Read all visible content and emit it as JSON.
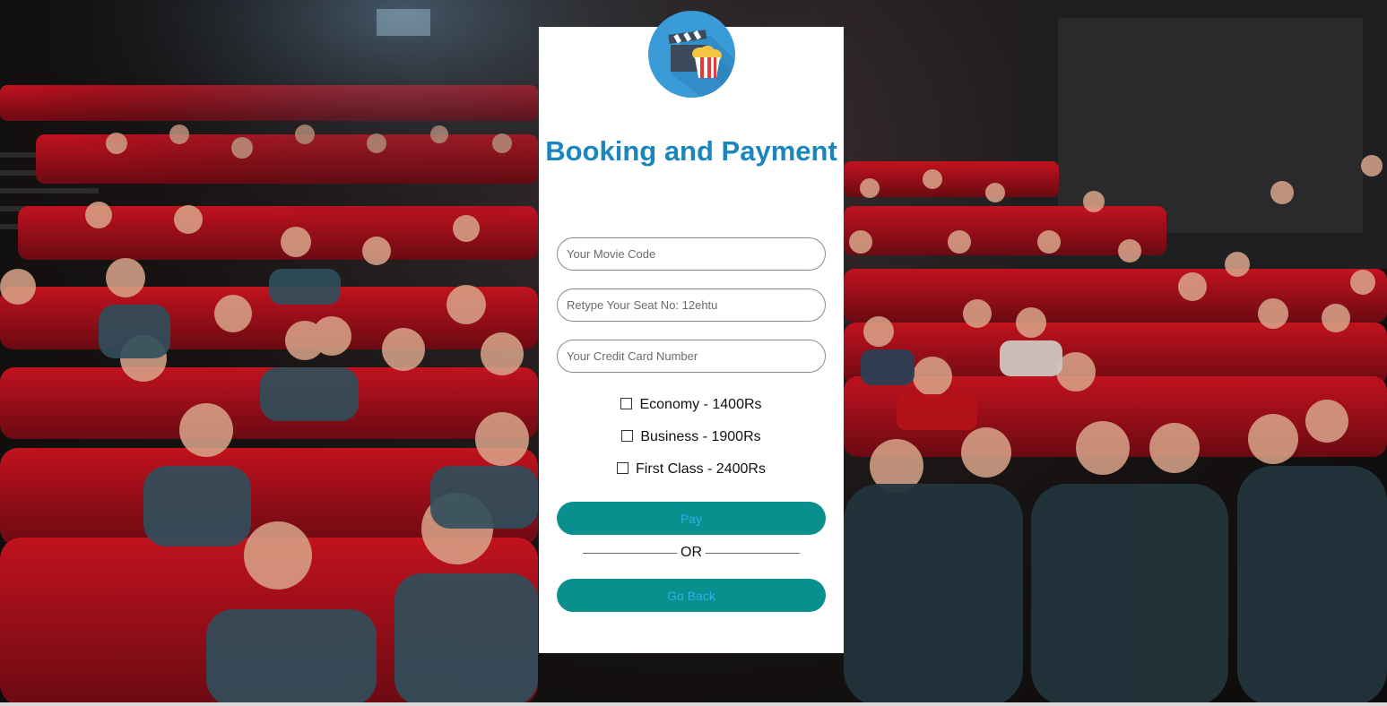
{
  "form": {
    "title": "Booking and Payment",
    "movie_code": {
      "placeholder": "Your Movie Code",
      "value": ""
    },
    "seat_no": {
      "placeholder": "Retype Your Seat No: 12ehtu",
      "value": ""
    },
    "credit_card": {
      "placeholder": "Your Credit Card Number",
      "value": ""
    },
    "options": [
      {
        "label": "Economy - 1400Rs",
        "checked": false
      },
      {
        "label": "Business - 1900Rs",
        "checked": false
      },
      {
        "label": "First Class - 2400Rs",
        "checked": false
      }
    ],
    "pay_label": "Pay",
    "separator": "OR",
    "back_label": "Go Back"
  },
  "icons": {
    "logo": "clapperboard-popcorn-icon",
    "checkbox": "checkbox-icon"
  },
  "colors": {
    "title": "#1b86bd",
    "button_bg": "#0a8f8f",
    "button_text": "#2bb0e8",
    "logo_bg": "#3a9bd9",
    "seat_red": "#a3101c"
  }
}
